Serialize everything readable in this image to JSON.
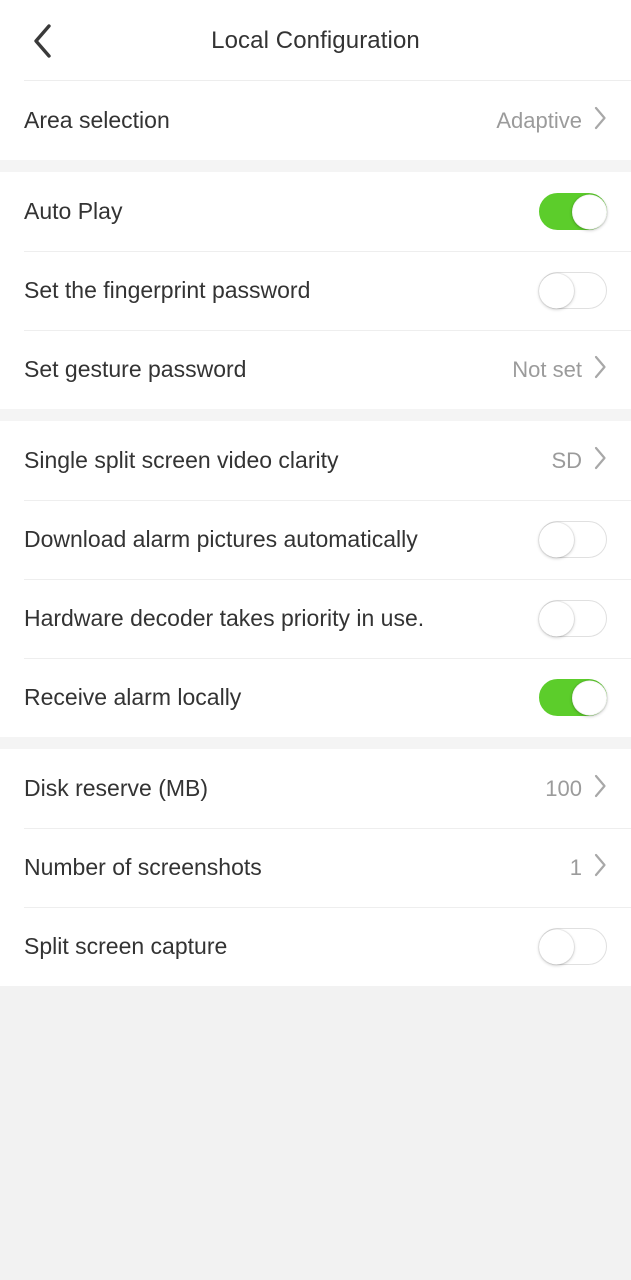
{
  "header": {
    "title": "Local Configuration",
    "back_icon": "chevron-left-icon"
  },
  "colors": {
    "toggle_on": "#5ccd2b",
    "toggle_off_track": "#ffffff",
    "label_text": "#333333",
    "value_text": "#9b9b9b",
    "page_background": "#f2f2f2",
    "row_background": "#ffffff",
    "separator": "#eeeeee"
  },
  "groups": [
    {
      "rows": [
        {
          "label": "Area selection",
          "type": "value",
          "value": "Adaptive",
          "accessory": "chevron-right-icon"
        }
      ]
    },
    {
      "rows": [
        {
          "label": "Auto Play",
          "type": "toggle",
          "state": "on"
        },
        {
          "label": "Set the fingerprint password",
          "type": "toggle",
          "state": "off"
        },
        {
          "label": "Set gesture password",
          "type": "value",
          "value": "Not set",
          "accessory": "chevron-right-icon"
        }
      ]
    },
    {
      "rows": [
        {
          "label": "Single split screen video clarity",
          "type": "value",
          "value": "SD",
          "accessory": "chevron-right-icon"
        },
        {
          "label": "Download alarm pictures automatically",
          "type": "toggle",
          "state": "off"
        },
        {
          "label": "Hardware decoder takes priority in use.",
          "type": "toggle",
          "state": "off"
        },
        {
          "label": "Receive alarm locally",
          "type": "toggle",
          "state": "on"
        }
      ]
    },
    {
      "rows": [
        {
          "label": "Disk reserve (MB)",
          "type": "value",
          "value": "100",
          "accessory": "chevron-right-icon"
        },
        {
          "label": "Number of screenshots",
          "type": "value",
          "value": "1",
          "accessory": "chevron-right-icon"
        },
        {
          "label": "Split screen capture",
          "type": "toggle",
          "state": "off"
        }
      ]
    }
  ]
}
